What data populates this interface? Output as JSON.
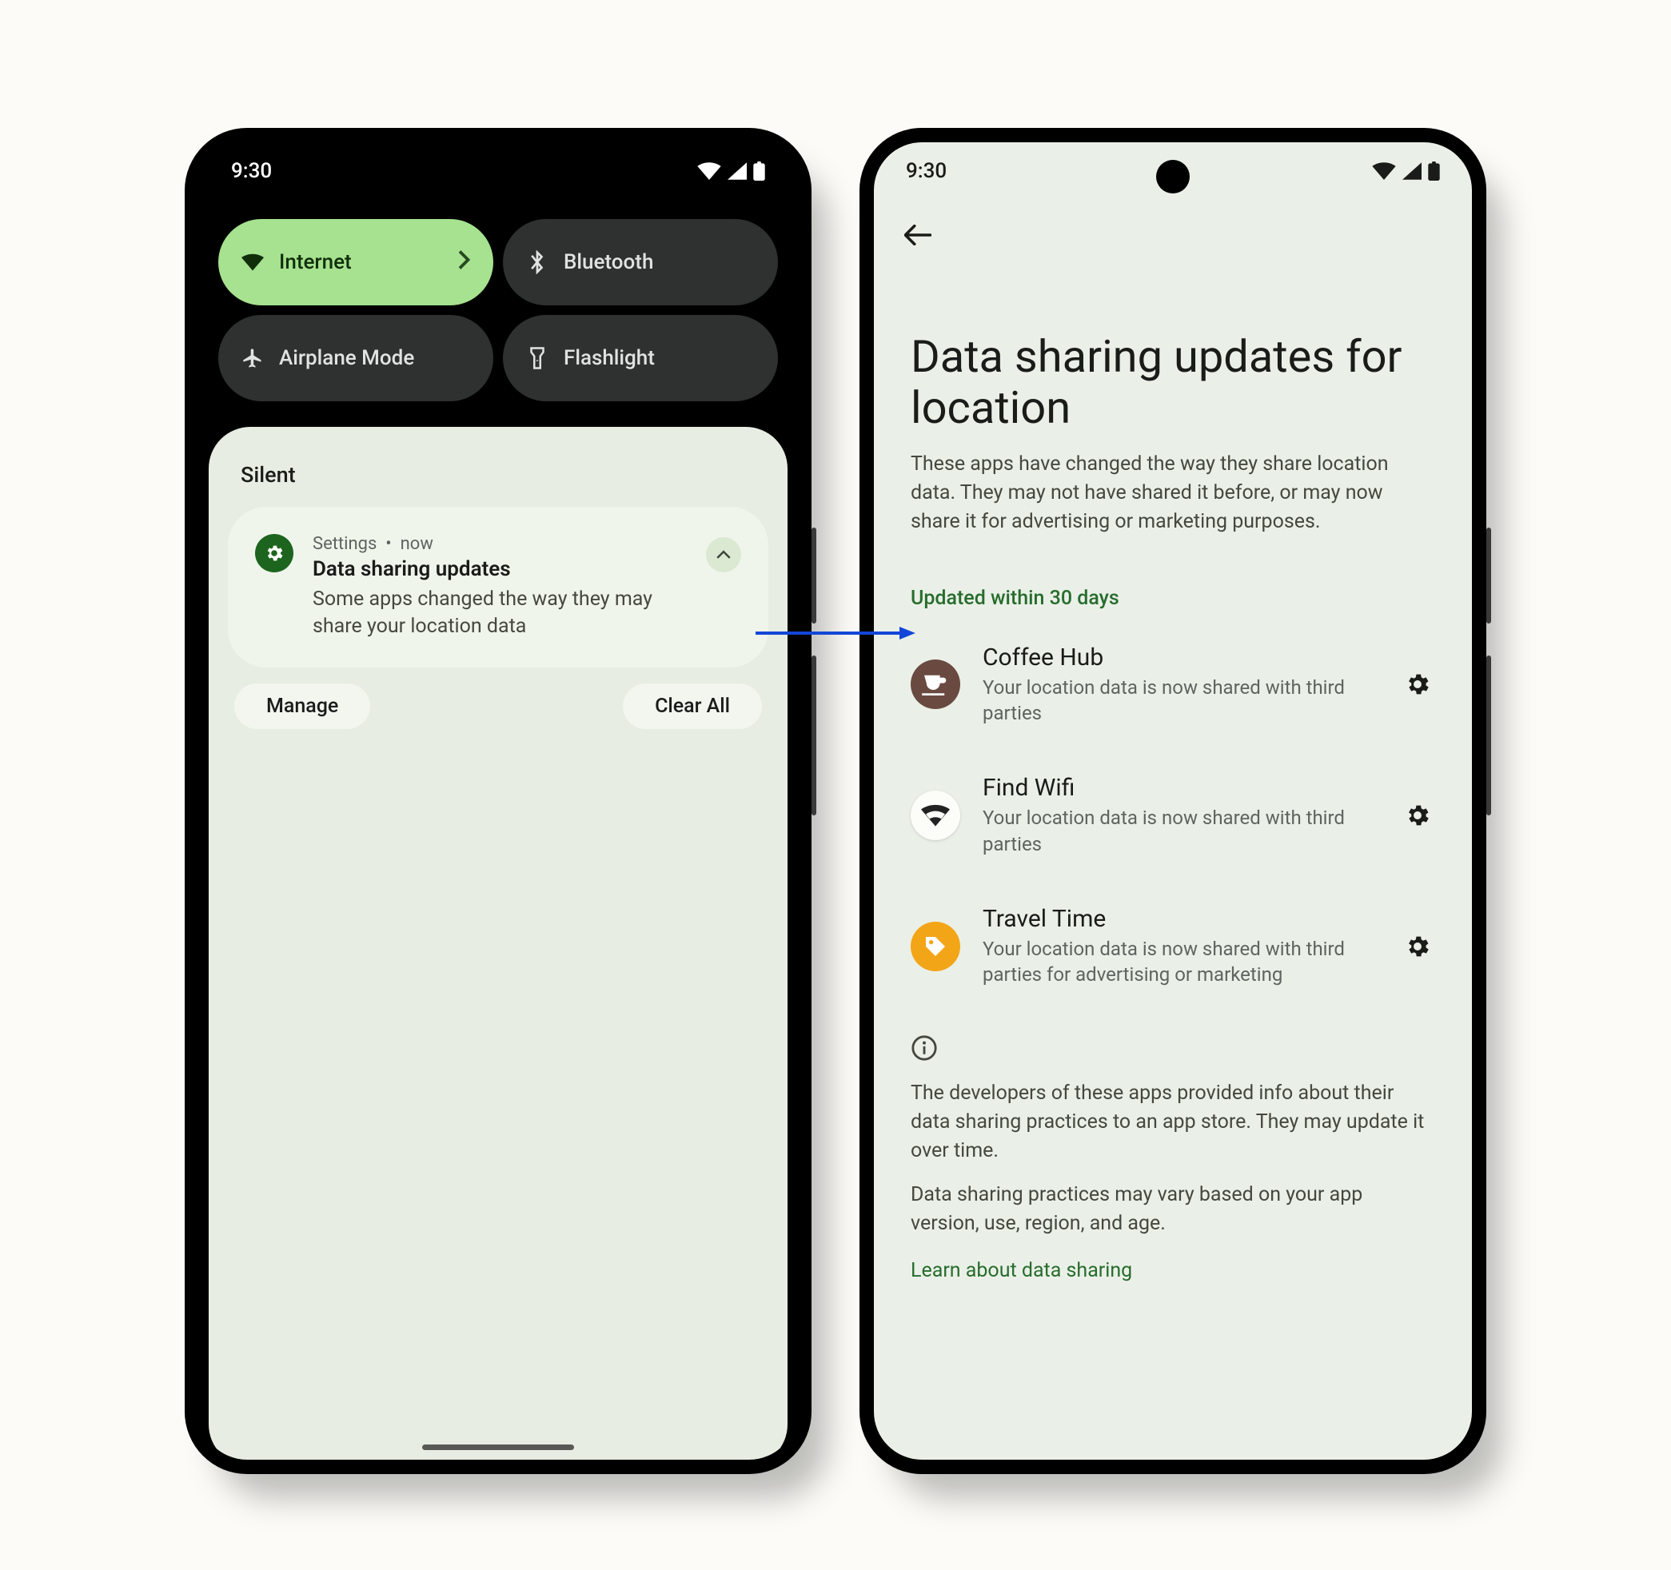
{
  "status": {
    "time": "9:30"
  },
  "qs": {
    "internet": "Internet",
    "bluetooth": "Bluetooth",
    "airplane": "Airplane Mode",
    "flashlight": "Flashlight"
  },
  "shade": {
    "section": "Silent",
    "notif": {
      "source": "Settings",
      "sep": "•",
      "when": "now",
      "title": "Data sharing updates",
      "body": "Some apps changed the way they may share your location data"
    },
    "manage": "Manage",
    "clear": "Clear All"
  },
  "page": {
    "title": "Data sharing updates for location",
    "subtitle": "These apps have changed the way they share location data. They may not have shared it before, or may now share it for advertising or marketing purposes.",
    "section": "Updated within 30 days",
    "apps": [
      {
        "name": "Coffee Hub",
        "desc": "Your location data is now shared with third parties"
      },
      {
        "name": "Find Wifi",
        "desc": "Your location data is now shared with third parties"
      },
      {
        "name": "Travel Time",
        "desc": "Your location data is now shared with third parties for advertising or marketing"
      }
    ],
    "info1": "The developers of these apps provided info about their data sharing practices to an app store. They may update it over time.",
    "info2": "Data sharing practices may vary based on your app version, use, region, and age.",
    "link": "Learn about data sharing"
  }
}
